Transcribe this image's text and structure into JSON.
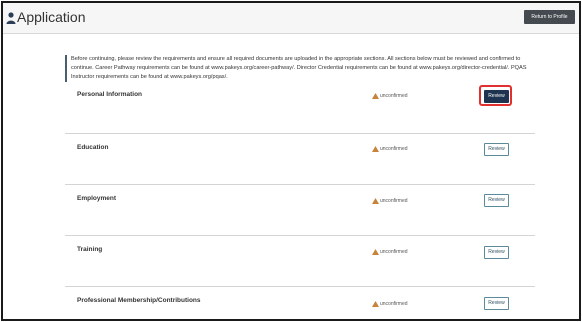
{
  "header": {
    "title": "Application",
    "return_button": "Return to Profile"
  },
  "notice": {
    "text": "Before continuing, please review the requirements and ensure all required documents are uploaded in the appropriate sections. All sections below must be reviewed and confirmed to continue. Career Pathway requirements can be found at www.pakeys.org/career-pathway/. Director Credential requirements can be found at www.pakeys.org/director-credential/. PQAS Instructor requirements can be found at www.pakeys.org/pqas/."
  },
  "sections": [
    {
      "title": "Personal Information",
      "status": "unconfirmed",
      "button": "Review",
      "active": true
    },
    {
      "title": "Education",
      "status": "unconfirmed",
      "button": "Review",
      "active": false
    },
    {
      "title": "Employment",
      "status": "unconfirmed",
      "button": "Review",
      "active": false
    },
    {
      "title": "Training",
      "status": "unconfirmed",
      "button": "Review",
      "active": false
    },
    {
      "title": "Professional Membership/Contributions",
      "status": "unconfirmed",
      "button": "Review",
      "active": false
    }
  ],
  "colors": {
    "accent": "#1d3350",
    "warning": "#c9823a",
    "highlight": "#e03030"
  }
}
